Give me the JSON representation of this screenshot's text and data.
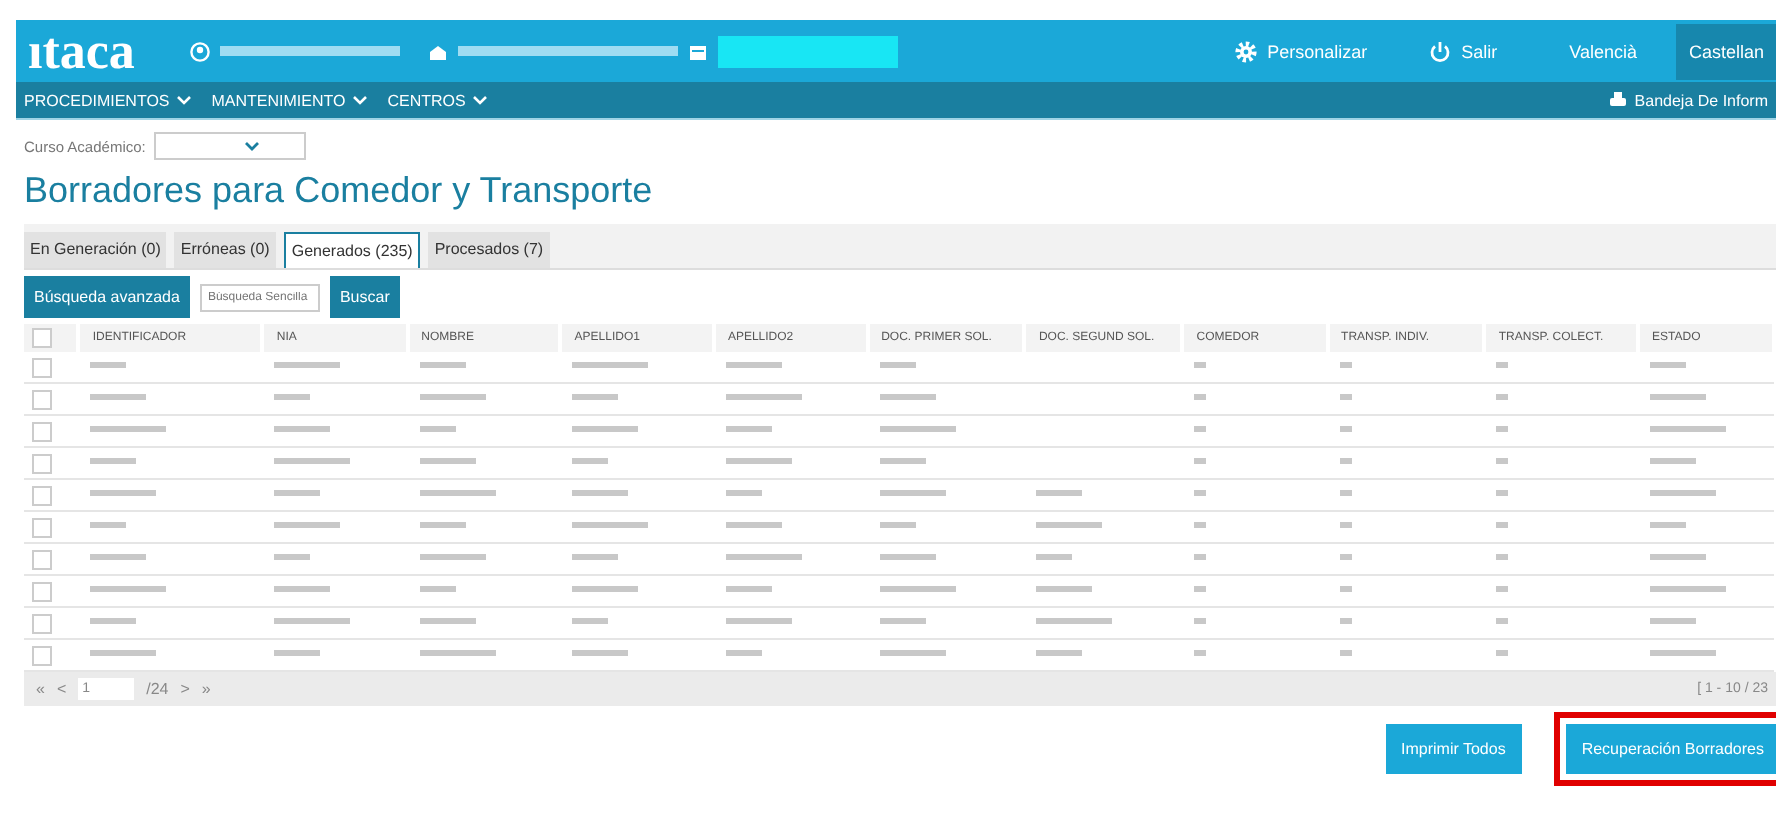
{
  "header": {
    "logo": "ıtaca",
    "links": [
      {
        "kind": "gear",
        "label": "Personalizar"
      },
      {
        "kind": "power",
        "label": "Salir"
      }
    ],
    "languages": [
      {
        "label": "Valencià",
        "selected": false
      },
      {
        "label": "Castellan",
        "selected": true
      }
    ]
  },
  "nav": {
    "menus": [
      "PROCEDIMIENTOS",
      "MANTENIMIENTO",
      "CENTROS"
    ],
    "tray": "Bandeja De Inform"
  },
  "filter": {
    "label": "Curso Académico:"
  },
  "title": "Borradores para Comedor y Transporte",
  "tabs": [
    {
      "label": "En Generación (0)",
      "selected": false
    },
    {
      "label": "Erróneas (0)",
      "selected": false
    },
    {
      "label": "Generados (235)",
      "selected": true
    },
    {
      "label": "Procesados (7)",
      "selected": false
    }
  ],
  "search": {
    "advanced": "Búsqueda avanzada",
    "placeholder": "Búsqueda Sencilla",
    "button": "Buscar"
  },
  "table": {
    "all_checked": false,
    "columns": [
      "IDENTIFICADOR",
      "NIA",
      "NOMBRE",
      "APELLIDO1",
      "APELLIDO2",
      "DOC. PRIMER SOL.",
      "DOC. SEGUND SOL.",
      "COMEDOR",
      "TRANSP. INDIV.",
      "TRANSP. COLECT.",
      "ESTADO"
    ],
    "rows": [
      {
        "checked": false,
        "second_doc": false
      },
      {
        "checked": false,
        "second_doc": false
      },
      {
        "checked": false,
        "second_doc": false
      },
      {
        "checked": false,
        "second_doc": false
      },
      {
        "checked": false,
        "second_doc": true
      },
      {
        "checked": false,
        "second_doc": true
      },
      {
        "checked": false,
        "second_doc": true
      },
      {
        "checked": false,
        "second_doc": true
      },
      {
        "checked": false,
        "second_doc": true
      },
      {
        "checked": false,
        "second_doc": true
      }
    ]
  },
  "pager": {
    "first": "«",
    "prev": "<",
    "page": "1",
    "total": "/24",
    "next": ">",
    "last": "»",
    "range": "[ 1 - 10 / 23"
  },
  "actions": [
    {
      "label": "Imprimir Todos",
      "highlighted": false
    },
    {
      "label": "Recuperación Borradores",
      "highlighted": true
    }
  ]
}
